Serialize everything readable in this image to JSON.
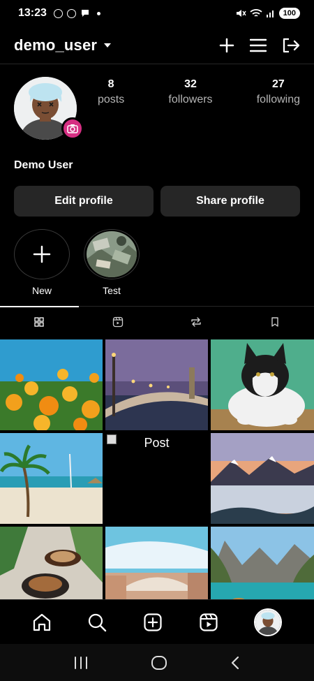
{
  "status_bar": {
    "time": "13:23",
    "battery": "100"
  },
  "header": {
    "username": "demo_user"
  },
  "profile": {
    "display_name": "Demo User",
    "stats": [
      {
        "num": "8",
        "label": "posts"
      },
      {
        "num": "32",
        "label": "followers"
      },
      {
        "num": "27",
        "label": "following"
      }
    ],
    "edit_label": "Edit profile",
    "share_label": "Share profile"
  },
  "highlights": [
    {
      "label": "New"
    },
    {
      "label": "Test"
    }
  ],
  "tabs": [
    "grid-icon",
    "reels-icon",
    "repost-icon",
    "bookmark-icon"
  ],
  "grid": {
    "broken_alt": "Post"
  },
  "colors": {
    "accent": "#d62f83",
    "button_bg": "#262626",
    "background": "#000000"
  }
}
